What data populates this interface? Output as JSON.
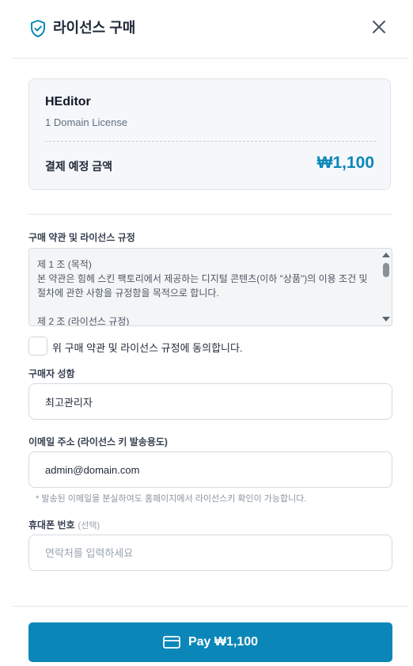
{
  "header": {
    "title": "라이선스 구매",
    "icon": "shield-check-icon",
    "close_icon": "close-icon"
  },
  "summary": {
    "product_name": "HEditor",
    "product_sub": "1 Domain License",
    "price_label": "결제 예정 금액",
    "price_value": "₩1,100"
  },
  "terms": {
    "heading": "구매 약관 및 라이선스 규정",
    "line1": "제 1 조 (목적)",
    "line2": "본 약관은 힘헤 스킨 팩토리에서 제공하는 디지털 콘텐츠(이하 \"상품\")의 이용 조건 및 절차에 관한 사항을 규정함을 목적으로 합니다.",
    "line3": "제 2 조 (라이선스 규정)"
  },
  "agree": {
    "label": "위 구매 약관 및 라이선스 규정에 동의합니다.",
    "checked": false
  },
  "buyer": {
    "label": "구매자 성함",
    "value": "최고관리자"
  },
  "email": {
    "label": "이메일 주소 (라이선스 키 발송용도)",
    "value": "admin@domain.com",
    "helper": "* 발송된 이메일을 분실하여도 홈페이지에서 라이선스키 확인이 가능합니다."
  },
  "phone": {
    "label": "휴대폰 번호",
    "optional": "(선택)",
    "value": "",
    "placeholder": "연락처를 입력하세요"
  },
  "pay_button": {
    "label": "Pay ₩1,100",
    "icon": "credit-card-icon"
  },
  "colors": {
    "accent": "#0a87b8",
    "card_bg": "#f5f7fa"
  }
}
